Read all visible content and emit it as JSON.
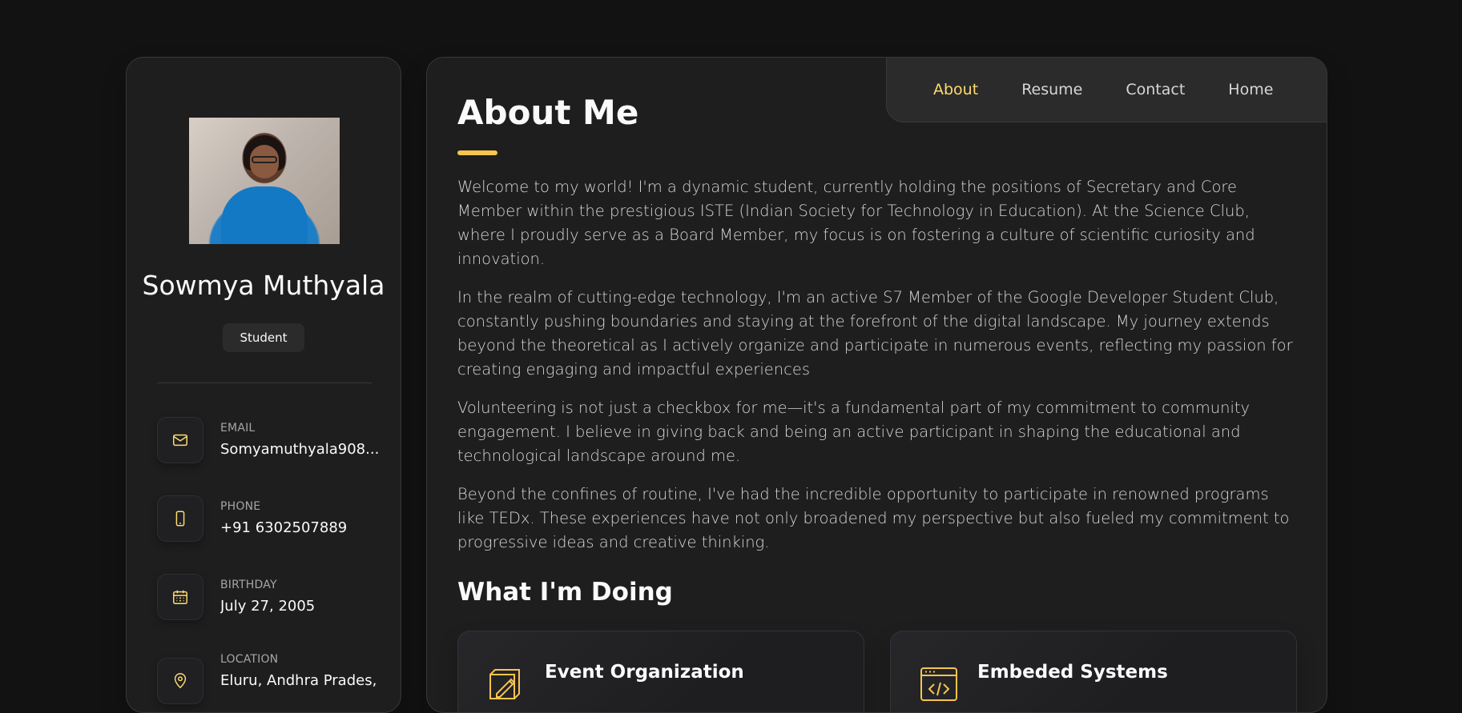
{
  "sidebar": {
    "name": "Sowmya Muthyala",
    "role": "Student",
    "contacts": [
      {
        "label": "Email",
        "value": "Somyamuthyala908...",
        "icon": "mail-icon"
      },
      {
        "label": "Phone",
        "value": "+91 6302507889",
        "icon": "phone-icon"
      },
      {
        "label": "Birthday",
        "value": "July 27, 2005",
        "icon": "calendar-icon"
      },
      {
        "label": "Location",
        "value": "Eluru, Andhra Prades,",
        "icon": "location-pin-icon"
      }
    ]
  },
  "nav": {
    "items": [
      "About",
      "Resume",
      "Contact",
      "Home"
    ],
    "active": "About"
  },
  "about": {
    "title": "About Me",
    "paragraphs": [
      "Welcome to my world! I'm a dynamic student, currently holding the positions of Secretary and Core Member within the prestigious ISTE (Indian Society for Technology in Education). At the Science Club, where I proudly serve as a Board Member, my focus is on fostering a culture of scientific curiosity and innovation.",
      "In the realm of cutting-edge technology, I'm an active S7 Member of the Google Developer Student Club, constantly pushing boundaries and staying at the forefront of the digital landscape. My journey extends beyond the theoretical as I actively organize and participate in numerous events, reflecting my passion for creating engaging and impactful experiences",
      "Volunteering is not just a checkbox for me—it's a fundamental part of my commitment to community engagement. I believe in giving back and being an active participant in shaping the educational and technological landscape around me.",
      "Beyond the confines of routine, I've had the incredible opportunity to participate in renowned programs like TEDx. These experiences have not only broadened my perspective but also fueled my commitment to progressive ideas and creative thinking."
    ]
  },
  "services": {
    "title": "What I'm Doing",
    "items": [
      {
        "title": "Event Organization",
        "icon": "event-sketch-icon"
      },
      {
        "title": "Embeded Systems",
        "icon": "code-window-icon"
      }
    ]
  },
  "colors": {
    "accent": "#ffdb70",
    "background": "#121212",
    "card": "#1e1e1f"
  }
}
